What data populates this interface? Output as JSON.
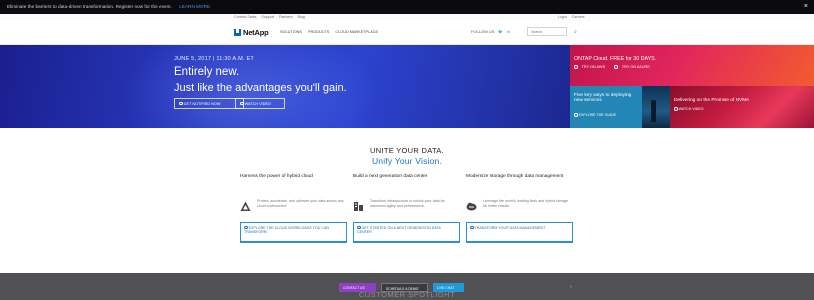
{
  "announcement": {
    "text": "Eliminate the barriers to data-driven transformation. Register now for the event.",
    "link": "LEARN MORE",
    "close": "×"
  },
  "utility": {
    "links": [
      "Contact Sales",
      "Support",
      "Partners",
      "Blog"
    ],
    "right_links": [
      "Login",
      "Careers"
    ]
  },
  "nav": {
    "logo": "NetApp",
    "menu": [
      "SOLUTIONS",
      "PRODUCTS",
      "CLOUD MARKETPLACE"
    ],
    "follow_label": "FOLLOW US",
    "social_icons": [
      "twitter-icon",
      "linkedin-icon"
    ],
    "search_placeholder": "Search"
  },
  "hero": {
    "date": "JUNE 5, 2017 | 11:30 A.M. ET",
    "headline": "Entirely new.",
    "subline": "Just like the advantages you'll gain.",
    "buttons": [
      "GET NOTIFIED NOW",
      "WATCH VIDEO"
    ]
  },
  "promos": {
    "ontap": {
      "title": "ONTAP Cloud. FREE for 30 DAYS.",
      "links": [
        "TRY ON AWS",
        "TRY ON AZURE"
      ]
    },
    "five_ways": {
      "title": "Five key ways to deploying new services",
      "link": "EXPLORE THE GUIDE"
    },
    "nvme": {
      "title": "Delivering on the Promise of NVMe",
      "link": "WATCH VIDEO"
    }
  },
  "section": {
    "title": "UNITE YOUR DATA.",
    "subtitle": "Unify Your Vision.",
    "columns": [
      {
        "heading": "Harness the power of hybrid cloud",
        "icon": "cloud-arrows-icon",
        "desc": "Protect, accelerate, and optimize your data across any cloud environment.",
        "cta": "EXPLORE THE CLOUD WORKLOADS YOU CAN TRANSFORM"
      },
      {
        "heading": "Build a next generation data center",
        "icon": "datacenter-icon",
        "desc": "Transform infrastructure to unlock your data for maximum agility and performance.",
        "cta": "GET STARTED ON A NEXT GENERATION DATA CENTER"
      },
      {
        "heading": "Modernize storage through data management",
        "icon": "storage-cloud-icon",
        "desc": "Leverage the world's leading flash and hybrid storage for better results.",
        "cta": "TRANSFORM YOUR DATA MANAGEMENT"
      }
    ]
  },
  "footer_band": {
    "title": "CUSTOMER SPOTLIGHT",
    "pills": [
      "CONTACT US",
      "SCHEDULE A DEMO",
      "LIVE CHAT"
    ]
  },
  "colors": {
    "accent": "#1478c8",
    "hero": "#2a3cc4",
    "ontap_tile": "#e2265c",
    "guide_tile": "#2386b5",
    "nvme_tile": "#c11a3f"
  }
}
